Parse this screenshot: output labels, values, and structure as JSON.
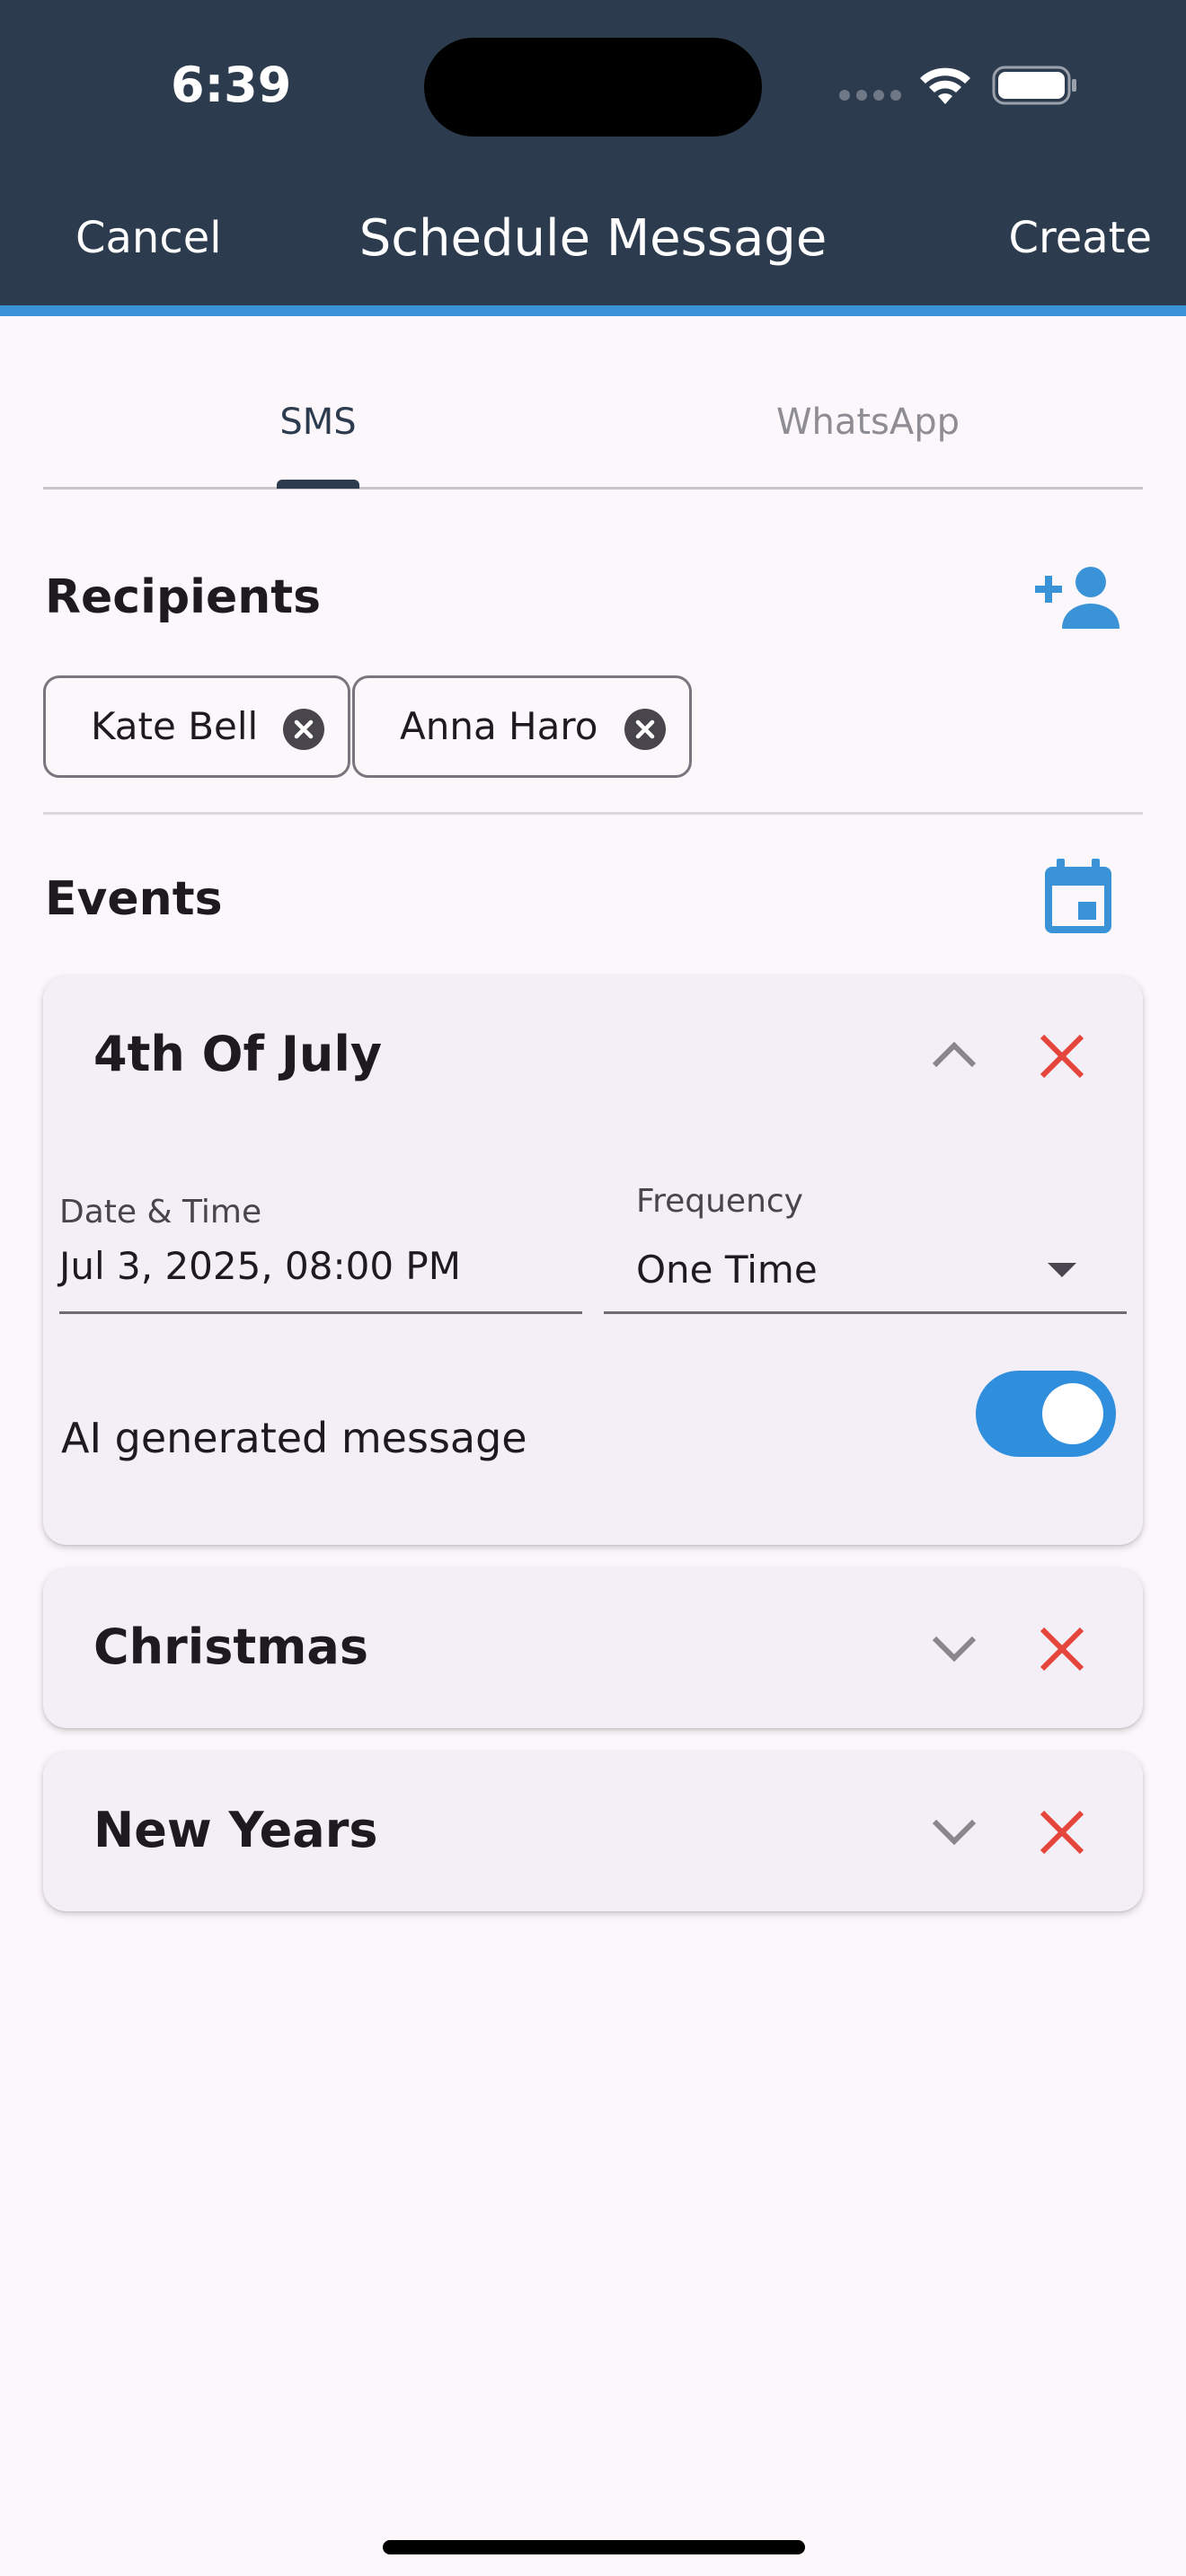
{
  "status_bar": {
    "time": "6:39"
  },
  "header": {
    "cancel_label": "Cancel",
    "title": "Schedule Message",
    "create_label": "Create"
  },
  "tabs": [
    {
      "label": "SMS",
      "selected": true
    },
    {
      "label": "WhatsApp",
      "selected": false
    }
  ],
  "recipients": {
    "title": "Recipients",
    "add_icon": "person-add-icon",
    "chips": [
      {
        "label": "Kate Bell"
      },
      {
        "label": "Anna Haro"
      }
    ]
  },
  "events": {
    "title": "Events",
    "add_icon": "calendar-icon",
    "items": [
      {
        "title": "4th Of July",
        "expanded": true,
        "date_label": "Date & Time",
        "date_value": "Jul 3, 2025, 08:00 PM",
        "frequency_label": "Frequency",
        "frequency_value": "One Time",
        "ai_label": "AI generated message",
        "ai_enabled": true
      },
      {
        "title": "Christmas",
        "expanded": false
      },
      {
        "title": "New Years",
        "expanded": false
      }
    ]
  },
  "colors": {
    "header_bg": "#2d3b4f",
    "accent": "#3a93d7",
    "delete_red": "#e5463b",
    "page_bg": "#fcf7fb",
    "card_bg": "#f4eff6"
  }
}
